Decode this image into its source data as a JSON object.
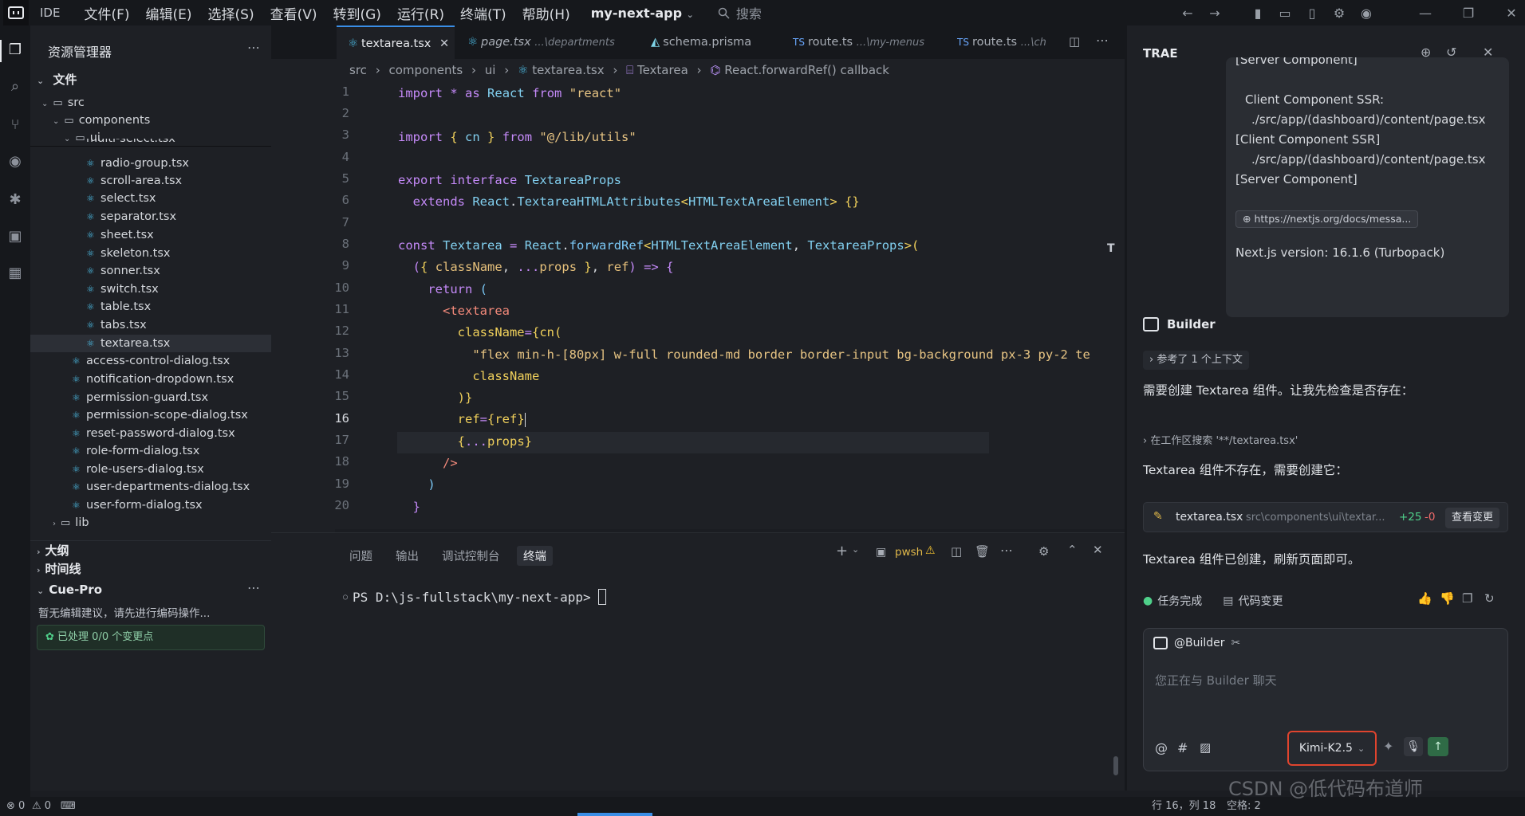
{
  "titlebar": {
    "ide_label": "IDE",
    "menus": [
      "文件(F)",
      "编辑(E)",
      "选择(S)",
      "查看(V)",
      "转到(G)",
      "运行(R)",
      "终端(T)",
      "帮助(H)"
    ],
    "project": "my-next-app",
    "search_label": "搜索"
  },
  "explorer": {
    "title": "资源管理器",
    "section_files": "文件",
    "items": [
      {
        "label": "src",
        "kind": "folder"
      },
      {
        "label": "components",
        "kind": "folder"
      },
      {
        "label": "ui",
        "kind": "folder"
      },
      {
        "label": "multi-select.tsx",
        "kind": "file"
      },
      {
        "label": "radio-group.tsx",
        "kind": "file"
      },
      {
        "label": "scroll-area.tsx",
        "kind": "file"
      },
      {
        "label": "select.tsx",
        "kind": "file"
      },
      {
        "label": "separator.tsx",
        "kind": "file"
      },
      {
        "label": "sheet.tsx",
        "kind": "file"
      },
      {
        "label": "skeleton.tsx",
        "kind": "file"
      },
      {
        "label": "sonner.tsx",
        "kind": "file"
      },
      {
        "label": "switch.tsx",
        "kind": "file"
      },
      {
        "label": "table.tsx",
        "kind": "file"
      },
      {
        "label": "tabs.tsx",
        "kind": "file"
      },
      {
        "label": "textarea.tsx",
        "kind": "file"
      },
      {
        "label": "access-control-dialog.tsx",
        "kind": "file"
      },
      {
        "label": "notification-dropdown.tsx",
        "kind": "file"
      },
      {
        "label": "permission-guard.tsx",
        "kind": "file"
      },
      {
        "label": "permission-scope-dialog.tsx",
        "kind": "file"
      },
      {
        "label": "reset-password-dialog.tsx",
        "kind": "file"
      },
      {
        "label": "role-form-dialog.tsx",
        "kind": "file"
      },
      {
        "label": "role-users-dialog.tsx",
        "kind": "file"
      },
      {
        "label": "user-departments-dialog.tsx",
        "kind": "file"
      },
      {
        "label": "user-form-dialog.tsx",
        "kind": "file"
      },
      {
        "label": "lib",
        "kind": "folder"
      }
    ],
    "outline": "大纲",
    "timeline": "时间线",
    "cue_title": "Cue-Pro",
    "cue_hint": "暂无编辑建议，请先进行编码操作...",
    "cue_status": "已处理 0/0 个变更点"
  },
  "tabs": [
    {
      "label": "textarea.tsx",
      "hint": ""
    },
    {
      "label": "page.tsx",
      "hint": "...\\departments"
    },
    {
      "label": "schema.prisma",
      "hint": ""
    },
    {
      "label": "route.ts",
      "hint": "...\\my-menus"
    },
    {
      "label": "route.ts",
      "hint": "...\\ch"
    }
  ],
  "breadcrumbs": [
    "src",
    "components",
    "ui",
    "textarea.tsx",
    "Textarea",
    "React.forwardRef() callback"
  ],
  "editor": {
    "line_numbers": [
      "1",
      "2",
      "3",
      "4",
      "5",
      "6",
      "7",
      "8",
      "9",
      "10",
      "11",
      "12",
      "13",
      "14",
      "15",
      "16",
      "17",
      "18",
      "19",
      "20"
    ],
    "current_line": 16
  },
  "panel": {
    "tabs": [
      "问题",
      "输出",
      "调试控制台",
      "终端"
    ],
    "shell": "pwsh",
    "prompt": "PS D:\\js-fullstack\\my-next-app> "
  },
  "chat": {
    "title": "TRAE",
    "bubble_lines": [
      "[Server Component]",
      "Client Component SSR:",
      "./src/app/(dashboard)/content/page.tsx",
      "[Client Component SSR]",
      "./src/app/(dashboard)/content/page.tsx",
      "[Server Component]"
    ],
    "link": "https://nextjs.org/docs/messa...",
    "version": "Next.js version: 16.1.6 (Turbopack)",
    "agent": "Builder",
    "context_ref": "参考了 1 个上下文",
    "msg1": "需要创建 Textarea 组件。让我先检查是否存在：",
    "search_ref": "在工作区搜索 '**/textarea.tsx'",
    "msg2": "Textarea 组件不存在，需要创建它：",
    "file_name": "textarea.tsx",
    "file_path": "src\\components\\ui\\textar...",
    "added": "+25",
    "removed": "-0",
    "view_changes": "查看变更",
    "msg3": "Textarea 组件已创建，刷新页面即可。",
    "task_done": "任务完成",
    "code_changes": "代码变更",
    "mention": "@Builder",
    "input_placeholder": "您正在与 Builder 聊天",
    "model": "Kimi-K2.5"
  },
  "statusbar": {
    "errors": "0",
    "warnings": "0",
    "position": "行 16，列 18",
    "spaces": "空格: 2",
    "watermark": "CSDN @低代码布道师"
  }
}
